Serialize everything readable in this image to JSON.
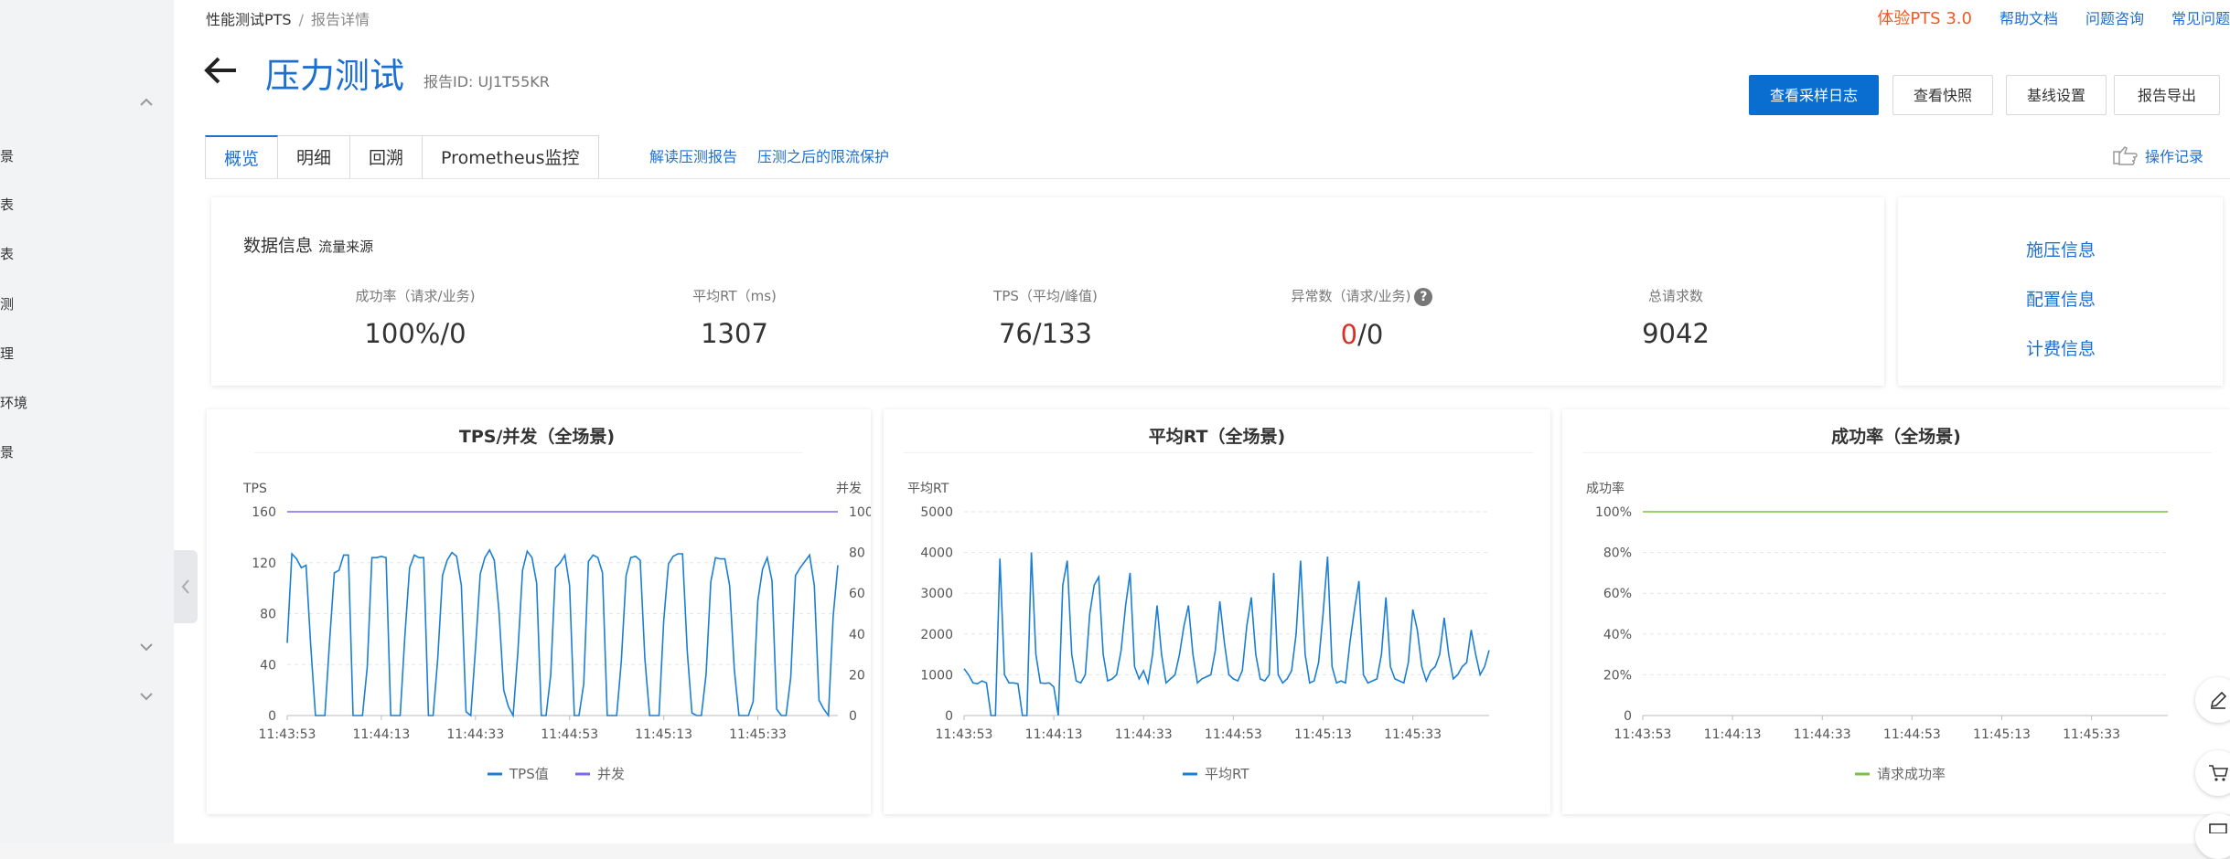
{
  "sidebar": {
    "items": [
      "景",
      "表",
      "表",
      "测",
      "理",
      "环境",
      "景"
    ]
  },
  "breadcrumb": {
    "root": "性能测试PTS",
    "separator": "/",
    "current": "报告详情"
  },
  "top_links": {
    "trial": "体验PTS 3.0",
    "docs": "帮助文档",
    "consult": "问题咨询",
    "faq": "常见问题"
  },
  "header": {
    "title": "压力测试",
    "report_id_label": "报告ID:",
    "report_id": "UJ1T55KR"
  },
  "actions": {
    "sample_log": "查看采样日志",
    "snapshot": "查看快照",
    "baseline": "基线设置",
    "export": "报告导出"
  },
  "tabs": [
    "概览",
    "明细",
    "回溯",
    "Prometheus监控"
  ],
  "tab_links": {
    "interpret": "解读压测报告",
    "protect": "压测之后的限流保护"
  },
  "operation_log": "操作记录",
  "data_info": {
    "title": "数据信息",
    "source": "流量来源",
    "metrics": {
      "success_label": "成功率（请求/业务)",
      "success_value": "100%/0",
      "rt_label": "平均RT（ms)",
      "rt_value": "1307",
      "tps_label": "TPS（平均/峰值)",
      "tps_value": "76/133",
      "error_label": "异常数（请求/业务)",
      "error_value_red": "0",
      "error_value_rest": "/0",
      "total_label": "总请求数",
      "total_value": "9042"
    }
  },
  "side_links": [
    "施压信息",
    "配置信息",
    "计费信息"
  ],
  "help_glyph": "?",
  "colors": {
    "accent": "#1e6fd0",
    "primary_button": "#0a6ed1",
    "error": "#d93026",
    "tps_line": "#1a7fd4",
    "concurrency_line": "#7b68ee",
    "success_line": "#7ac142"
  },
  "chart_data": [
    {
      "type": "line",
      "title": "TPS/并发（全场景)",
      "ylabel": "TPS",
      "y2label": "并发",
      "ylim": [
        0,
        160
      ],
      "y2lim": [
        0,
        100
      ],
      "yticks": [
        "0",
        "40",
        "80",
        "120",
        "160"
      ],
      "y2ticks": [
        "0",
        "20",
        "40",
        "60",
        "80",
        "100"
      ],
      "xticks": [
        "11:43:53",
        "11:44:13",
        "11:44:33",
        "11:44:53",
        "11:45:13",
        "11:45:33"
      ],
      "x_count": 118,
      "x_tick_index": [
        0,
        20,
        40,
        60,
        80,
        100
      ],
      "legend_position": "bottom",
      "series": [
        {
          "name": "TPS值",
          "axis": "left",
          "values": [
            57,
            127,
            123,
            116,
            118,
            55,
            0,
            0,
            0,
            58,
            112,
            114,
            126,
            126,
            0,
            0,
            0,
            38,
            124,
            124,
            125,
            124,
            0,
            0,
            0,
            62,
            116,
            126,
            124,
            124,
            0,
            0,
            45,
            110,
            122,
            128,
            125,
            102,
            3,
            0,
            52,
            111,
            124,
            130,
            122,
            82,
            20,
            7,
            0,
            49,
            114,
            129,
            124,
            104,
            0,
            0,
            32,
            116,
            120,
            126,
            102,
            0,
            0,
            25,
            121,
            126,
            124,
            112,
            0,
            0,
            0,
            43,
            110,
            124,
            125,
            122,
            45,
            0,
            0,
            0,
            74,
            119,
            125,
            127,
            127,
            50,
            2,
            0,
            0,
            32,
            105,
            124,
            123,
            123,
            102,
            36,
            0,
            0,
            0,
            11,
            90,
            115,
            124,
            106,
            5,
            0,
            0,
            30,
            110,
            116,
            121,
            126,
            102,
            12,
            5,
            0,
            78,
            118
          ]
        },
        {
          "name": "并发",
          "axis": "right",
          "values": [
            100,
            100,
            100,
            100,
            100,
            100,
            100,
            100,
            100,
            100,
            100,
            100,
            100,
            100,
            100,
            100,
            100,
            100,
            100,
            100,
            100,
            100,
            100,
            100,
            100,
            100,
            100,
            100,
            100,
            100,
            100,
            100,
            100,
            100,
            100,
            100,
            100,
            100,
            100,
            100,
            100,
            100,
            100,
            100,
            100,
            100,
            100,
            100,
            100,
            100,
            100,
            100,
            100,
            100,
            100,
            100,
            100,
            100,
            100,
            100,
            100,
            100,
            100,
            100,
            100,
            100,
            100,
            100,
            100,
            100,
            100,
            100,
            100,
            100,
            100,
            100,
            100,
            100,
            100,
            100,
            100,
            100,
            100,
            100,
            100,
            100,
            100,
            100,
            100,
            100,
            100,
            100,
            100,
            100,
            100,
            100,
            100,
            100,
            100,
            100,
            100,
            100,
            100,
            100,
            100,
            100,
            100,
            100,
            100,
            100,
            100,
            100,
            100,
            100,
            100,
            100,
            100,
            100
          ]
        }
      ]
    },
    {
      "type": "line",
      "title": "平均RT（全场景)",
      "ylabel": "平均RT",
      "ylim": [
        0,
        5000
      ],
      "yticks": [
        "0",
        "1000",
        "2000",
        "3000",
        "4000",
        "5000"
      ],
      "xticks": [
        "11:43:53",
        "11:44:13",
        "11:44:33",
        "11:44:53",
        "11:45:13",
        "11:45:33"
      ],
      "x_count": 118,
      "x_tick_index": [
        0,
        20,
        40,
        60,
        80,
        100
      ],
      "legend_position": "bottom",
      "series": [
        {
          "name": "平均RT",
          "values": [
            1150,
            1000,
            800,
            780,
            850,
            800,
            0,
            0,
            3850,
            1000,
            800,
            800,
            780,
            0,
            0,
            4000,
            1500,
            800,
            790,
            800,
            700,
            0,
            3200,
            3800,
            1500,
            850,
            800,
            1000,
            2500,
            3200,
            3400,
            1500,
            850,
            900,
            1000,
            1600,
            2700,
            3500,
            1200,
            900,
            1100,
            800,
            1500,
            2700,
            1500,
            800,
            900,
            1000,
            1500,
            2200,
            2700,
            1500,
            800,
            900,
            950,
            1000,
            1600,
            2800,
            1800,
            1000,
            900,
            850,
            1100,
            2200,
            2900,
            1500,
            900,
            850,
            1000,
            3500,
            1000,
            800,
            900,
            1100,
            2000,
            3800,
            1500,
            800,
            850,
            1300,
            2500,
            3900,
            1200,
            800,
            850,
            800,
            1800,
            2600,
            3300,
            1000,
            800,
            850,
            900,
            1500,
            2900,
            1200,
            900,
            850,
            800,
            1300,
            2600,
            2100,
            1200,
            850,
            1100,
            1200,
            1500,
            2400,
            1500,
            900,
            1000,
            1200,
            1300,
            2100,
            1500,
            1000,
            1200,
            1600
          ]
        }
      ]
    },
    {
      "type": "line",
      "title": "成功率（全场景)",
      "ylabel": "成功率",
      "ylim": [
        0,
        100
      ],
      "yticks": [
        "0",
        "20%",
        "40%",
        "60%",
        "80%",
        "100%"
      ],
      "xticks": [
        "11:43:53",
        "11:44:13",
        "11:44:33",
        "11:44:53",
        "11:45:13",
        "11:45:33"
      ],
      "x_count": 118,
      "x_tick_index": [
        0,
        20,
        40,
        60,
        80,
        100
      ],
      "legend_position": "bottom",
      "series": [
        {
          "name": "请求成功率",
          "values": [
            100,
            100,
            100,
            100,
            100,
            100,
            100,
            100,
            100,
            100,
            100,
            100,
            100,
            100,
            100,
            100,
            100,
            100,
            100,
            100,
            100,
            100,
            100,
            100,
            100,
            100,
            100,
            100,
            100,
            100,
            100,
            100,
            100,
            100,
            100,
            100,
            100,
            100,
            100,
            100,
            100,
            100,
            100,
            100,
            100,
            100,
            100,
            100,
            100,
            100,
            100,
            100,
            100,
            100,
            100,
            100,
            100,
            100,
            100,
            100,
            100,
            100,
            100,
            100,
            100,
            100,
            100,
            100,
            100,
            100,
            100,
            100,
            100,
            100,
            100,
            100,
            100,
            100,
            100,
            100,
            100,
            100,
            100,
            100,
            100,
            100,
            100,
            100,
            100,
            100,
            100,
            100,
            100,
            100,
            100,
            100,
            100,
            100,
            100,
            100,
            100,
            100,
            100,
            100,
            100,
            100,
            100,
            100,
            100,
            100,
            100,
            100,
            100,
            100,
            100,
            100,
            100,
            100
          ]
        }
      ]
    }
  ]
}
